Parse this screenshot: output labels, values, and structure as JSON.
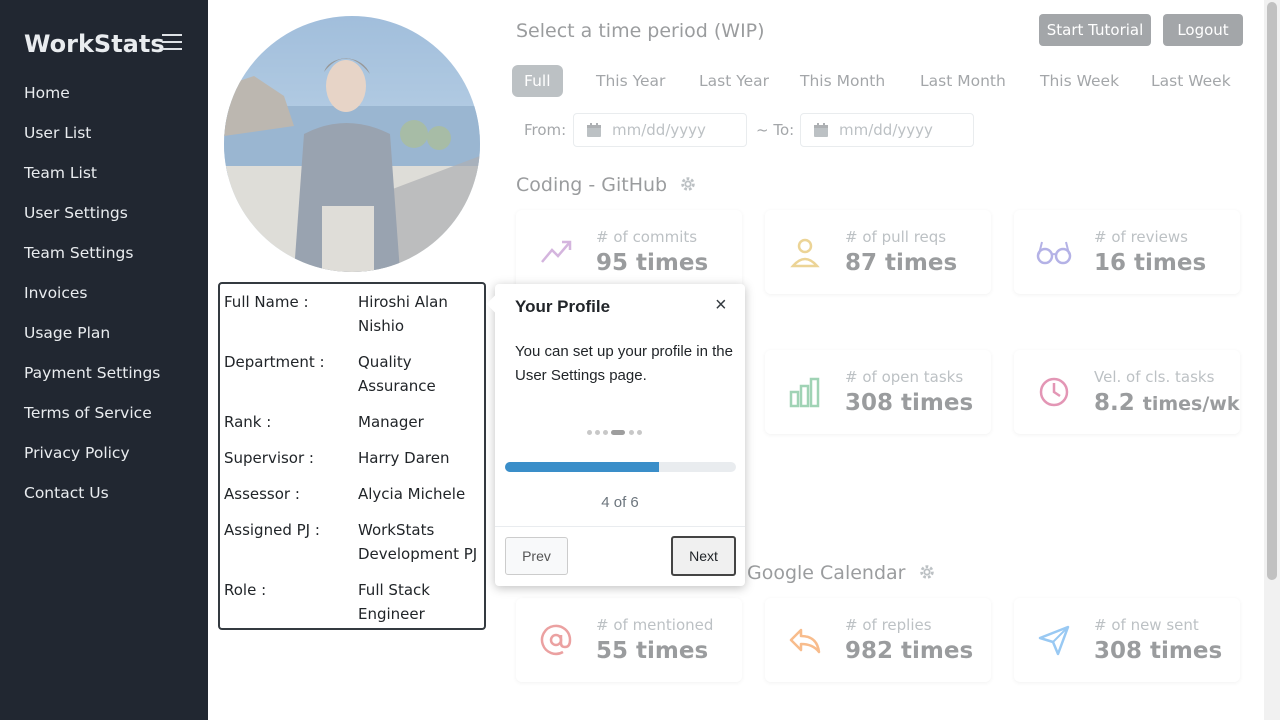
{
  "sidebar": {
    "brand": "WorkStats",
    "items": [
      {
        "label": "Home"
      },
      {
        "label": "User List"
      },
      {
        "label": "Team List"
      },
      {
        "label": "User Settings"
      },
      {
        "label": "Team Settings"
      },
      {
        "label": "Invoices"
      },
      {
        "label": "Usage Plan"
      },
      {
        "label": "Payment Settings"
      },
      {
        "label": "Terms of Service"
      },
      {
        "label": "Privacy Policy"
      },
      {
        "label": "Contact Us"
      }
    ]
  },
  "header": {
    "period_title": "Select a time period (WIP)",
    "start_tutorial": "Start Tutorial",
    "logout": "Logout"
  },
  "periods": {
    "full": "Full",
    "this_year": "This Year",
    "last_year": "Last Year",
    "this_month": "This Month",
    "last_month": "Last Month",
    "this_week": "This Week",
    "last_week": "Last Week",
    "active": "Full"
  },
  "date_range": {
    "from_label": "From:",
    "to_label": "~ To:",
    "from_placeholder": "mm/dd/yyyy",
    "to_placeholder": "mm/dd/yyyy"
  },
  "profile": {
    "rows": [
      {
        "label": "Full Name :",
        "value": "Hiroshi Alan Nishio"
      },
      {
        "label": "Department :",
        "value": "Quality Assurance"
      },
      {
        "label": "Rank :",
        "value": "Manager"
      },
      {
        "label": "Supervisor :",
        "value": "Harry Daren"
      },
      {
        "label": "Assessor :",
        "value": "Alycia Michele"
      },
      {
        "label": "Assigned PJ :",
        "value": "WorkStats Development PJ"
      },
      {
        "label": "Role :",
        "value": "Full Stack Engineer"
      }
    ]
  },
  "github": {
    "title": "Coding - GitHub",
    "cards": [
      {
        "label": "# of commits",
        "value": "95 times",
        "icon": "trend-up-icon",
        "color": "#a05bb5"
      },
      {
        "label": "# of pull reqs",
        "value": "87 times",
        "icon": "user-icon",
        "color": "#d4a017"
      },
      {
        "label": "# of reviews",
        "value": "16 times",
        "icon": "glasses-icon",
        "color": "#5a55c8"
      }
    ]
  },
  "tasks": {
    "cards": [
      {
        "label": "# of open tasks",
        "value": "308 times",
        "icon": "bar-chart-icon",
        "color": "#2e9e5b"
      },
      {
        "label": "Vel. of cls. tasks",
        "value": "8.2",
        "unit": "times/wk",
        "icon": "clock-icon",
        "color": "#c2185b"
      }
    ]
  },
  "calendar": {
    "title": "Google Calendar",
    "cards": [
      {
        "label": "# of mentioned",
        "value": "55 times",
        "icon": "at-icon",
        "color": "#d32f2f"
      },
      {
        "label": "# of replies",
        "value": "982 times",
        "icon": "reply-icon",
        "color": "#ef6c00"
      },
      {
        "label": "# of new sent",
        "value": "308 times",
        "icon": "send-icon",
        "color": "#1e88e5"
      }
    ]
  },
  "tour": {
    "title": "Your Profile",
    "close": "×",
    "body": "You can set up your profile in the User Settings page.",
    "step": 4,
    "total": 6,
    "progress": 0.667,
    "counter": "4 of 6",
    "prev": "Prev",
    "next": "Next"
  }
}
